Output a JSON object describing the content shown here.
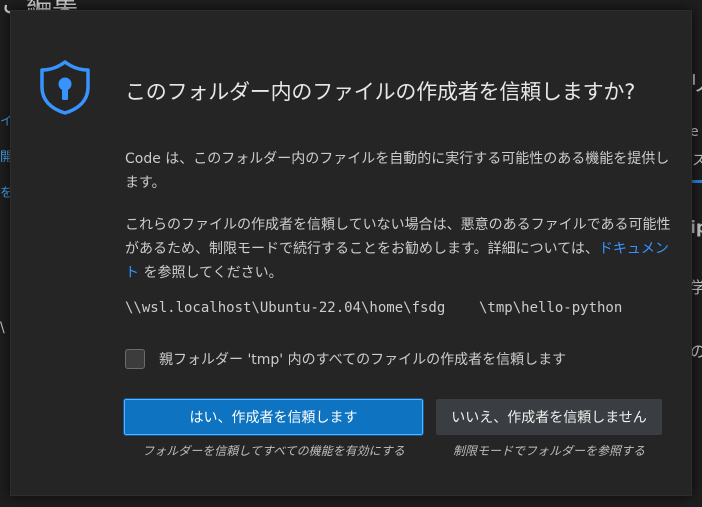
{
  "background": {
    "title_fragment": "こ編集",
    "right_fragments": [
      "リ",
      "e",
      "ス",
      "ip",
      "学",
      "の"
    ],
    "left_fragments": [
      "イ",
      "開",
      "を",
      "\\"
    ],
    "accent_color": "#2f7fd6"
  },
  "dialog": {
    "icon": "shield-lock-icon",
    "title": "このフォルダー内のファイルの作成者を信頼しますか?",
    "description1": "Code は、このフォルダー内のファイルを自動的に実行する可能性のある機能を提供します。",
    "description2_prefix": "これらのファイルの作成者を信頼していない場合は、悪意のあるファイルである可能性があるため、制限モードで続行することをお勧めします。詳細については、",
    "description2_link": "ドキュメント",
    "description2_suffix": " を参照してください。",
    "path": "\\\\wsl.localhost\\Ubuntu-22.04\\home\\fsdg    \\tmp\\hello-python",
    "checkbox_label": "親フォルダー 'tmp' 内のすべてのファイルの作成者を信頼します",
    "checkbox_checked": false,
    "trust_button": "はい、作成者を信頼します",
    "trust_caption": "フォルダーを信頼してすべての機能を有効にする",
    "restrict_button": "いいえ、作成者を信頼しません",
    "restrict_caption": "制限モードでフォルダーを参照する",
    "colors": {
      "primary_button": "#0e74c2",
      "link": "#3794ff",
      "shield": "#3794ff"
    }
  }
}
